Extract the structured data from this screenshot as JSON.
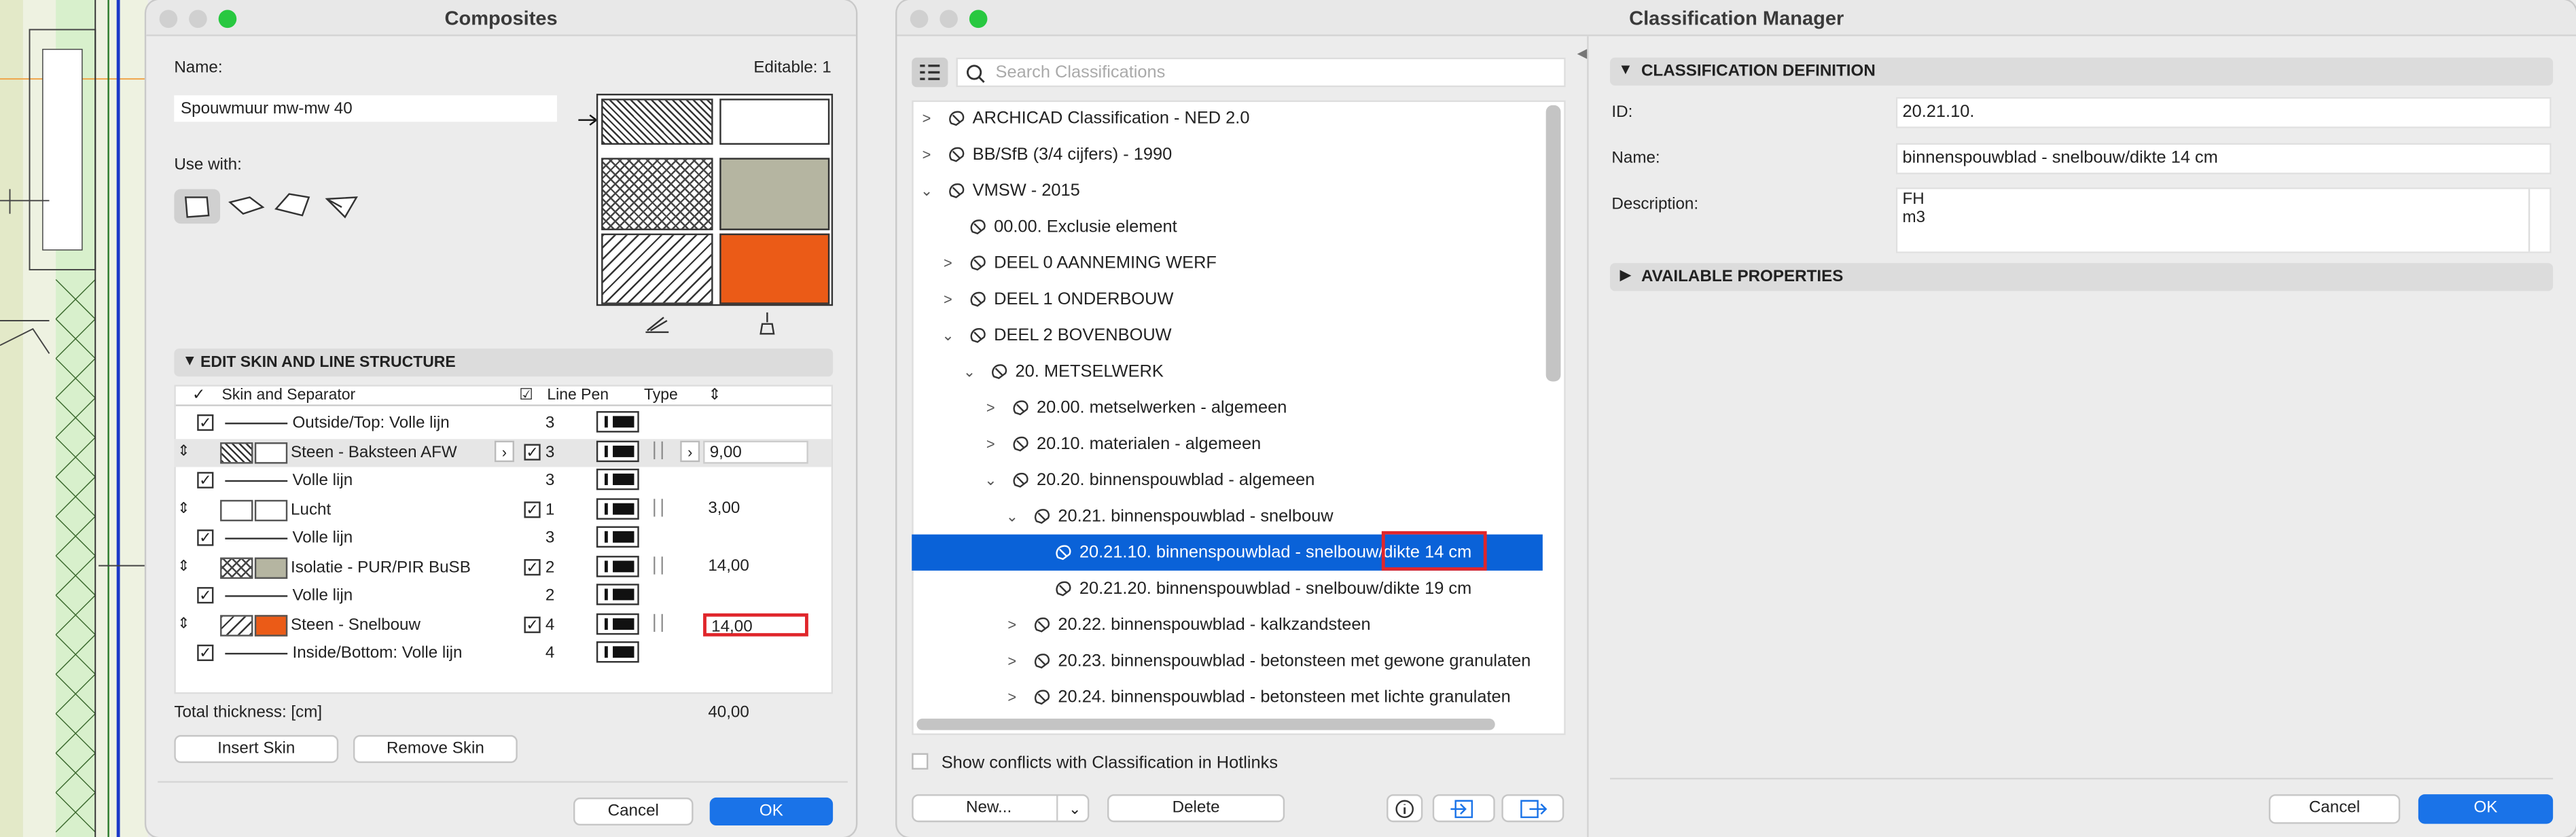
{
  "composites": {
    "title": "Composites",
    "name_label": "Name:",
    "name_value": "Spouwmuur mw-mw 40",
    "editable": "Editable: 1",
    "use_with_label": "Use with:",
    "section_title": "EDIT SKIN AND LINE STRUCTURE",
    "headers": {
      "skin": "Skin and Separator",
      "line_pen": "Line Pen",
      "type": "Type"
    },
    "rows": [
      {
        "kind": "line",
        "label": "Outside/Top: Volle lijn",
        "pen": "3"
      },
      {
        "kind": "skin",
        "label": "Steen - Baksteen AFW",
        "pen": "3",
        "thickness": "9,00",
        "fill": "#ffffff",
        "pattern": "hatch1"
      },
      {
        "kind": "line",
        "label": "Volle lijn",
        "pen": "3"
      },
      {
        "kind": "skin",
        "label": "Lucht",
        "pen": "1",
        "thickness": "3,00",
        "fill": "#ffffff",
        "pattern": "none"
      },
      {
        "kind": "line",
        "label": "Volle lijn",
        "pen": "3"
      },
      {
        "kind": "skin",
        "label": "Isolatie - PUR/PIR BuSB",
        "pen": "2",
        "thickness": "14,00",
        "fill": "#b5b5a1",
        "pattern": "cross"
      },
      {
        "kind": "line",
        "label": "Volle lijn",
        "pen": "2"
      },
      {
        "kind": "skin",
        "label": "Steen - Snelbouw",
        "pen": "4",
        "thickness": "14,00",
        "fill": "#eb5b17",
        "pattern": "diag"
      },
      {
        "kind": "line",
        "label": "Inside/Bottom: Volle lijn",
        "pen": "4"
      }
    ],
    "total_label": "Total thickness: [cm]",
    "total_value": "40,00",
    "insert_skin": "Insert Skin",
    "remove_skin": "Remove Skin",
    "cancel": "Cancel",
    "ok": "OK",
    "colors": {
      "orange": "#eb5b17",
      "olive": "#b5b5a1",
      "accent": "#1a73e8",
      "highlight": "#e0262b"
    }
  },
  "classification": {
    "title": "Classification Manager",
    "search_placeholder": "Search Classifications",
    "tree": [
      {
        "level": 0,
        "chev": "›",
        "label": "ARCHICAD Classification - NED 2.0"
      },
      {
        "level": 0,
        "chev": "›",
        "label": "BB/SfB (3/4 cijfers) - 1990"
      },
      {
        "level": 0,
        "chev": "⌄",
        "label": "VMSW - 2015"
      },
      {
        "level": 1,
        "chev": "",
        "label": "00.00. Exclusie element"
      },
      {
        "level": 1,
        "chev": "›",
        "label": "DEEL 0 AANNEMING WERF"
      },
      {
        "level": 1,
        "chev": "›",
        "label": "DEEL 1 ONDERBOUW"
      },
      {
        "level": 1,
        "chev": "⌄",
        "label": "DEEL 2 BOVENBOUW"
      },
      {
        "level": 2,
        "chev": "⌄",
        "label": "20. METSELWERK"
      },
      {
        "level": 3,
        "chev": "›",
        "label": "20.00. metselwerken - algemeen"
      },
      {
        "level": 3,
        "chev": "›",
        "label": "20.10. materialen - algemeen"
      },
      {
        "level": 3,
        "chev": "⌄",
        "label": "20.20. binnenspouwblad - algemeen"
      },
      {
        "level": 4,
        "chev": "⌄",
        "label": "20.21. binnenspouwblad - snelbouw"
      },
      {
        "level": 5,
        "chev": "",
        "label": "20.21.10. binnenspouwblad - snelbouw/dikte 14 cm",
        "selected": true
      },
      {
        "level": 5,
        "chev": "",
        "label": "20.21.20. binnenspouwblad - snelbouw/dikte 19 cm"
      },
      {
        "level": 4,
        "chev": "›",
        "label": "20.22. binnenspouwblad - kalkzandsteen"
      },
      {
        "level": 4,
        "chev": "›",
        "label": "20.23. binnenspouwblad - betonsteen met gewone granulaten"
      },
      {
        "level": 4,
        "chev": "›",
        "label": "20.24. binnenspouwblad - betonsteen met lichte granulaten"
      }
    ],
    "show_conflicts": "Show conflicts with Classification in Hotlinks",
    "new_btn": "New...",
    "delete_btn": "Delete",
    "definition_title": "CLASSIFICATION DEFINITION",
    "id_label": "ID:",
    "id_value": "20.21.10.",
    "name_label": "Name:",
    "name_value": "binnenspouwblad - snelbouw/dikte 14 cm",
    "desc_label": "Description:",
    "desc_line1": "FH",
    "desc_line2": "m3",
    "available_title": "AVAILABLE PROPERTIES",
    "cancel": "Cancel",
    "ok": "OK"
  }
}
